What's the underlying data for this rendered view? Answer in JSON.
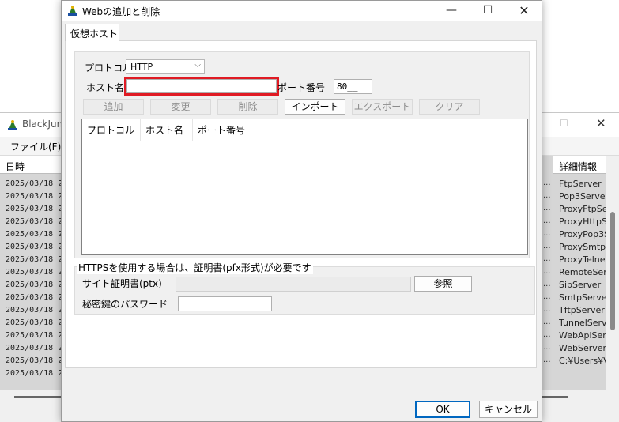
{
  "background_window": {
    "title": "BlackJum",
    "menu_file": "ファイル(F)",
    "col_date": "日時",
    "col_detail": "詳細情報",
    "rows_date": [
      "2025/03/18 2",
      "2025/03/18 2",
      "2025/03/18 2",
      "2025/03/18 2",
      "2025/03/18 2",
      "2025/03/18 2",
      "2025/03/18 2",
      "2025/03/18 2",
      "2025/03/18 2",
      "2025/03/18 2",
      "2025/03/18 2",
      "2025/03/18 2",
      "2025/03/18 2",
      "2025/03/18 2",
      "2025/03/18 2",
      "2025/03/18 2"
    ],
    "rows_detail": [
      "FtpServer",
      "Pop3Server",
      "ProxyFtpSe",
      "ProxyHttpS",
      "ProxyPop3S",
      "ProxySmtpS",
      "ProxyTelne",
      "RemoteServ",
      "SipServer",
      "SmtpServer",
      "TftpServer",
      "TunnelServ",
      "WebApiServ",
      "WebServer",
      "C:¥Users¥V"
    ],
    "dots": "..."
  },
  "dialog": {
    "title": "Webの追加と削除",
    "tab_label": "仮想ホスト",
    "protocol_label": "プロトコル",
    "protocol_value": "HTTP",
    "host_label": "ホスト名",
    "host_value": "",
    "port_label": "ポート番号",
    "port_value": "80__",
    "buttons": {
      "add": "追加",
      "change": "変更",
      "delete": "削除",
      "import": "インポート",
      "export": "エクスポート",
      "clear": "クリア"
    },
    "list_columns": [
      "プロトコル",
      "ホスト名",
      "ポート番号"
    ],
    "https_caption": "HTTPSを使用する場合は、証明書(pfx形式)が必要です",
    "cert_label": "サイト証明書(ptx)",
    "browse_label": "参照",
    "password_label": "秘密鍵のパスワード",
    "ok_label": "OK",
    "cancel_label": "キャンセル"
  },
  "colors": {
    "highlight": "#e01b24",
    "dialog_bg": "#f0f0f0",
    "default_button_border": "#0067c0"
  }
}
